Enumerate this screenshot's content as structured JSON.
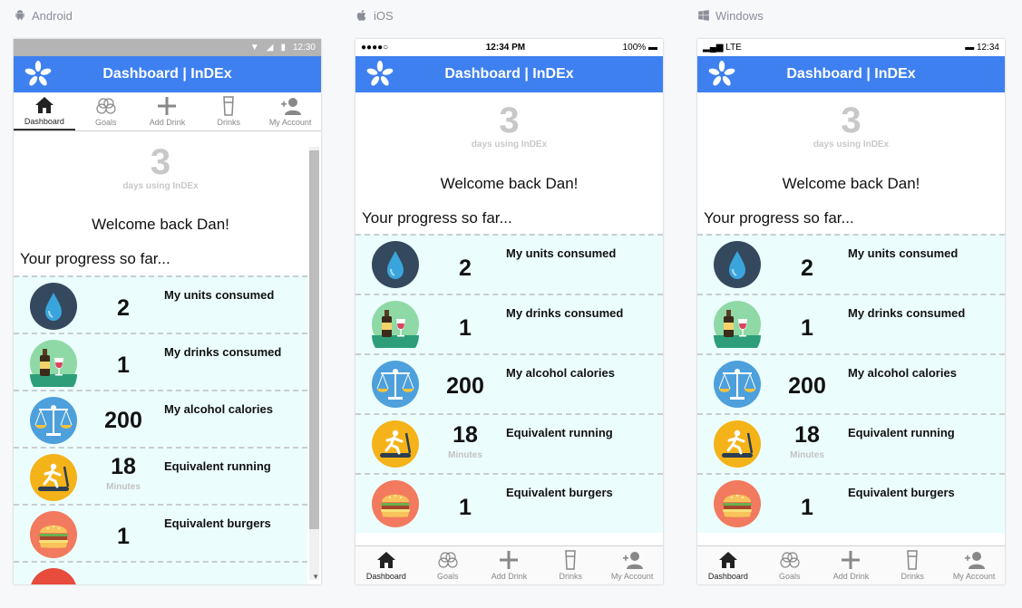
{
  "platforms": {
    "android": {
      "label": "Android",
      "status_time": "12:30"
    },
    "ios": {
      "label": "iOS",
      "status_carrier": "●●●●○",
      "status_time": "12:34 PM",
      "status_battery": "100%"
    },
    "windows": {
      "label": "Windows",
      "status_signal": "LTE",
      "status_time": "12:34"
    }
  },
  "app": {
    "title": "Dashboard | InDEx",
    "days_count": "3",
    "days_label": "days using InDEx",
    "welcome": "Welcome back Dan!",
    "progress_title": "Your progress so far..."
  },
  "tabs": [
    {
      "label": "Dashboard",
      "icon": "home-icon"
    },
    {
      "label": "Goals",
      "icon": "goals-icon"
    },
    {
      "label": "Add Drink",
      "icon": "plus-icon"
    },
    {
      "label": "Drinks",
      "icon": "glass-icon"
    },
    {
      "label": "My Account",
      "icon": "add-user-icon"
    }
  ],
  "stats": [
    {
      "label": "My units consumed",
      "value": "2",
      "unit": "",
      "icon": "water-drop-icon"
    },
    {
      "label": "My drinks consumed",
      "value": "1",
      "unit": "",
      "icon": "wine-bottle-icon"
    },
    {
      "label": "My alcohol calories",
      "value": "200",
      "unit": "",
      "icon": "scales-icon"
    },
    {
      "label": "Equivalent running",
      "value": "18",
      "unit": "Minutes",
      "icon": "treadmill-icon"
    },
    {
      "label": "Equivalent burgers",
      "value": "1",
      "unit": "",
      "icon": "burger-icon"
    }
  ],
  "colors": {
    "accent": "#3e80ef",
    "stat_background": "#ecfdfd"
  }
}
